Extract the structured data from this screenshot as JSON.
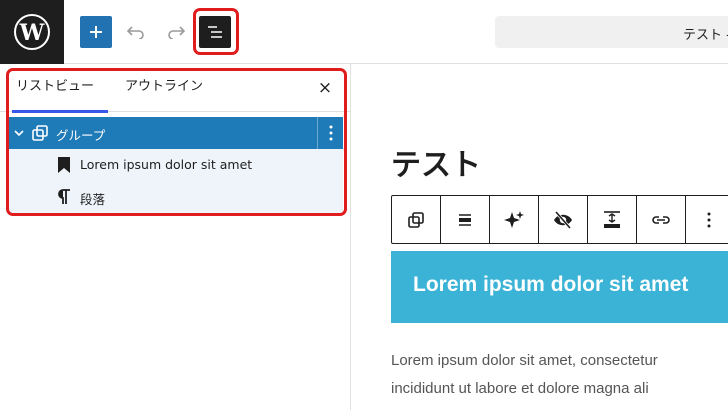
{
  "document": {
    "title": "テスト -"
  },
  "list_view": {
    "tabs": [
      "リストビュー",
      "アウトライン"
    ],
    "close_symbol": "×",
    "items": [
      {
        "label": "グループ",
        "icon": "group-icon",
        "selected": true
      },
      {
        "label": "Lorem ipsum dolor sit amet",
        "icon": "bookmark-icon"
      },
      {
        "label": "段落",
        "icon": "paragraph-icon"
      }
    ]
  },
  "editor": {
    "post_title": "テスト",
    "group_heading": "Lorem ipsum dolor sit amet",
    "paragraph_line1": "Lorem ipsum dolor sit amet, consectetur",
    "paragraph_line2": "incididunt ut labore et dolore magna ali"
  },
  "colors": {
    "accent": "#1f7ab8",
    "group_bg": "#3bb3d6",
    "highlight": "#e01c1c",
    "tab_indicator": "#3858e9"
  }
}
